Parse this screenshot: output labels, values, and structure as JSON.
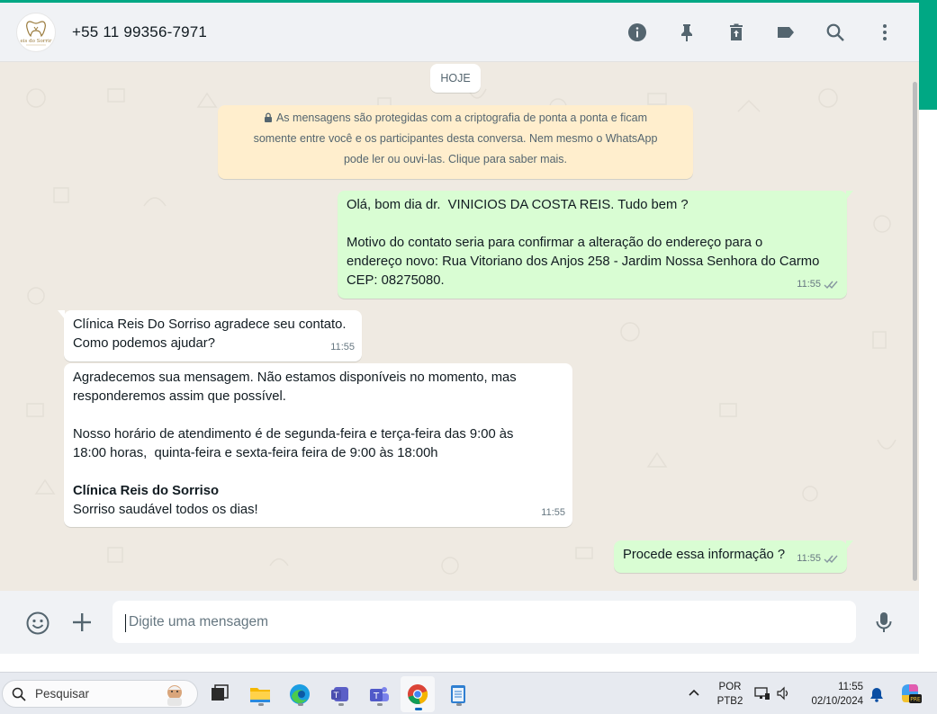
{
  "header": {
    "contact_name": "+55 11 99356-7971",
    "avatar_text": "eis do Sorrir",
    "icons": [
      "info-icon",
      "pin-icon",
      "delete-chat-icon",
      "label-icon",
      "search-icon",
      "menu-icon"
    ]
  },
  "chat": {
    "date_chip": "HOJE",
    "encryption_notice": {
      "lines": [
        "As mensagens são protegidas com a criptografia de ponta a ponta e ficam",
        "somente entre você e os participantes desta conversa. Nem mesmo o WhatsApp",
        "pode ler ou ouvi-las. Clique para saber mais."
      ]
    },
    "messages": [
      {
        "direction": "out",
        "lines": [
          "Olá, bom dia dr.  VINICIOS DA COSTA REIS. Tudo bem ?",
          "",
          "Motivo do contato seria para confirmar a alteração do endereço para o",
          "endereço novo: Rua Vitoriano dos Anjos 258 - Jardim Nossa Senhora do Carmo",
          "CEP: 08275080."
        ],
        "time": "11:55",
        "status": "read"
      },
      {
        "direction": "in",
        "lines": [
          "Clínica Reis Do Sorriso agradece seu contato.",
          "Como podemos ajudar?"
        ],
        "time": "11:55"
      },
      {
        "direction": "in",
        "lines": [
          "Agradecemos sua mensagem. Não estamos disponíveis no momento, mas",
          "responderemos assim que possível.",
          "",
          "Nosso horário de atendimento é de segunda-feira e terça-feira das 9:00 às",
          "18:00 horas,  quinta-feira e sexta-feira feira de 9:00 às 18:00h",
          "",
          "Clínica Reis do Sorriso",
          "Sorriso saudável todos os dias!"
        ],
        "bold_line": "Clínica Reis do Sorriso",
        "time": "11:55"
      },
      {
        "direction": "out",
        "lines": [
          "Procede essa informação ?"
        ],
        "time": "11:55",
        "status": "read"
      }
    ]
  },
  "composer": {
    "placeholder": "Digite uma mensagem"
  },
  "taskbar": {
    "search_placeholder": "Pesquisar",
    "language_line1": "POR",
    "language_line2": "PTB2",
    "time": "11:55",
    "date": "02/10/2024",
    "copilot_badge": "PRE"
  },
  "colors": {
    "accent": "#00a884",
    "outgoing_bubble": "#d9fdd3",
    "incoming_bubble": "#ffffff",
    "encryption_bg": "#ffeecd",
    "chat_bg": "#efeae2",
    "header_bg": "#f0f2f5",
    "read_ticks": "#8696a0"
  }
}
